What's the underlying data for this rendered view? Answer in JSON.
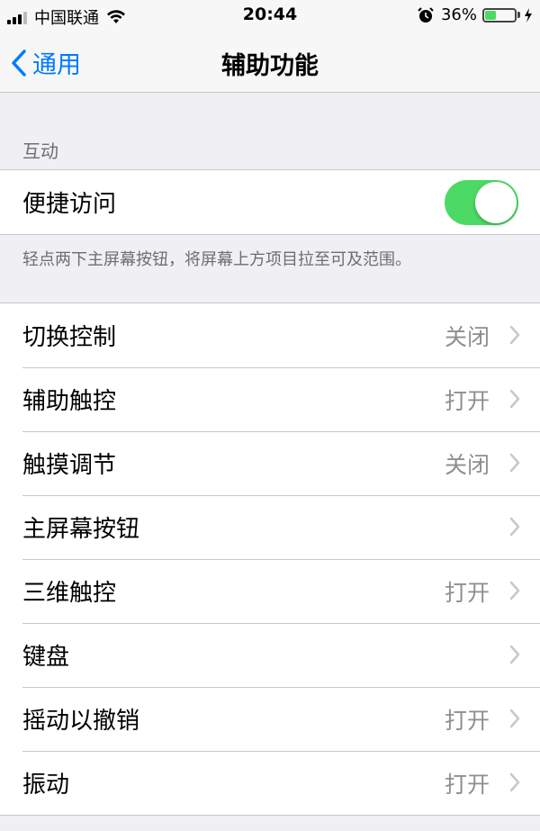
{
  "status_bar": {
    "carrier": "中国联通",
    "time": "20:44",
    "battery_percent": "36%",
    "battery_level": 0.36,
    "icons": [
      "signal-icon",
      "wifi-icon",
      "alarm-icon",
      "battery-icon",
      "charging-icon"
    ]
  },
  "nav": {
    "back_label": "通用",
    "title": "辅助功能"
  },
  "section": {
    "header": "互动",
    "toggle_row": {
      "label": "便捷访问",
      "on": true,
      "accent": "#4cd964"
    },
    "footer": "轻点两下主屏幕按钮，将屏幕上方项目拉至可及范围。"
  },
  "list": [
    {
      "label": "切换控制",
      "value": "关闭"
    },
    {
      "label": "辅助触控",
      "value": "打开"
    },
    {
      "label": "触摸调节",
      "value": "关闭"
    },
    {
      "label": "主屏幕按钮",
      "value": ""
    },
    {
      "label": "三维触控",
      "value": "打开"
    },
    {
      "label": "键盘",
      "value": ""
    },
    {
      "label": "摇动以撤销",
      "value": "打开"
    },
    {
      "label": "振动",
      "value": "打开"
    }
  ],
  "colors": {
    "link": "#007aff",
    "background": "#efeff4",
    "secondary_text": "#8e8e93"
  }
}
